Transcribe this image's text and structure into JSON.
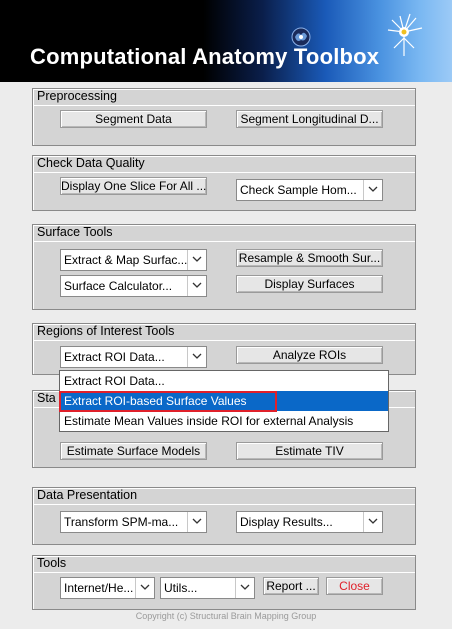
{
  "title": "Computational Anatomy Toolbox",
  "copyright": "Copyright (c) Structural Brain Mapping Group",
  "panels": {
    "preprocessing": {
      "title": "Preprocessing",
      "segment_data": "Segment Data",
      "segment_longitudinal": "Segment Longitudinal D..."
    },
    "quality": {
      "title": "Check Data Quality",
      "display_slice": "Display One Slice For All ...",
      "check_sample": "Check Sample Hom..."
    },
    "surface": {
      "title": "Surface Tools",
      "extract_map": "Extract & Map Surfac...",
      "resample": "Resample & Smooth Sur...",
      "calculator": "Surface Calculator...",
      "display_surfaces": "Display Surfaces"
    },
    "roi": {
      "title": "Regions of Interest Tools",
      "extract_roi": "Extract ROI Data...",
      "analyze": "Analyze ROIs"
    },
    "stats": {
      "title": "Sta",
      "estimate_surface": "Estimate Surface Models",
      "estimate_tiv": "Estimate TIV"
    },
    "presentation": {
      "title": "Data Presentation",
      "transform": "Transform SPM-ma...",
      "display_results": "Display Results..."
    },
    "tools": {
      "title": "Tools",
      "internet": "Internet/He...",
      "utils": "Utils...",
      "report": "Report ...",
      "close": "Close"
    }
  },
  "dropdown": {
    "items": [
      "Extract ROI Data...",
      "Extract ROI-based Surface Values",
      "Estimate Mean Values inside ROI for external Analysis"
    ]
  },
  "colors": {
    "highlight": "#0a68c8",
    "close_text": "#e0202a",
    "annotation": "#e0202a"
  }
}
